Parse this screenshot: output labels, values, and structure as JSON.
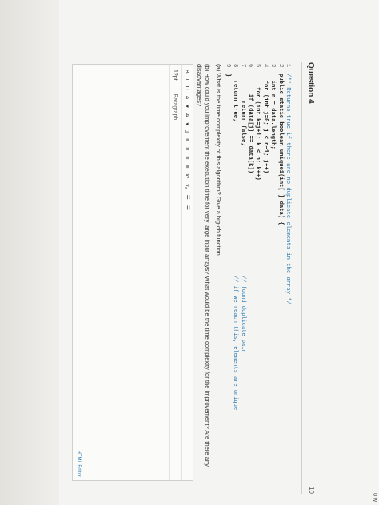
{
  "question": {
    "title": "Question 4",
    "points": "10",
    "corner": "0 w"
  },
  "code": [
    {
      "n": "1",
      "text": "/** Returns true if there are no duplicate elements in the array */",
      "comment": true
    },
    {
      "n": "2",
      "text": "public static boolean unique1(int[ ] data) {",
      "bold": true
    },
    {
      "n": "3",
      "text": "  int n = data.length;",
      "bold": true
    },
    {
      "n": "4",
      "text": "  for (int j=0; j < n−1; j++)",
      "bold": true
    },
    {
      "n": "5",
      "text": "    for (int k=j+1; k < n; k++)",
      "bold": true
    },
    {
      "n": "6",
      "text": "      if (data[j] == data[k])",
      "bold": true
    },
    {
      "n": "7",
      "text": "        return false;",
      "bold": true
    },
    {
      "n": "8",
      "text": "  return true;",
      "bold": true
    },
    {
      "n": "9",
      "text": "}",
      "bold": true
    }
  ],
  "comments": {
    "c7": "// found duplicate pair",
    "c8": "// if we reach this, elements are unique"
  },
  "prompt": {
    "a": "(a) What is the time complexity of this algorithm? Give a big-oh function.",
    "b": "(b) How could you improvement the execution time for very large input arrays? What would be the time complexity for the improvement? Are there any disadvantages?"
  },
  "editor": {
    "toolbar": [
      "B",
      "I",
      "U",
      "A",
      "▾",
      "A",
      "▾",
      "I̲",
      "≡",
      "≡",
      "≡",
      "≡",
      "x²",
      "x₂",
      "☰",
      "☰"
    ],
    "font_size": "12pt",
    "paragraph": "Paragraph",
    "html_editor": "HTML Editor"
  },
  "colors": {
    "accent": "#2a7ab0"
  }
}
